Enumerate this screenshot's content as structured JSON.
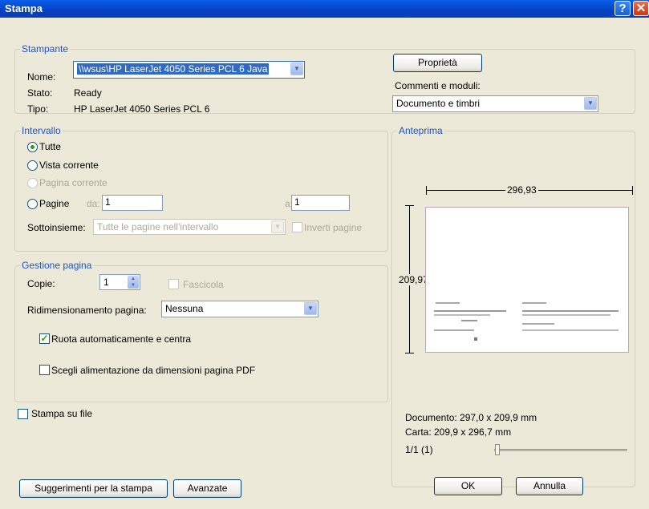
{
  "window": {
    "title": "Stampa"
  },
  "printer": {
    "group_label": "Stampante",
    "name_label": "Nome:",
    "name_value": "\\\\wsus\\HP LaserJet 4050 Series PCL 6 Java",
    "status_label": "Stato:",
    "status_value": "Ready",
    "type_label": "Tipo:",
    "type_value": "HP LaserJet 4050 Series PCL 6",
    "properties_button": "Proprietà",
    "comments_label": "Commenti e moduli:",
    "comments_value": "Documento e timbri"
  },
  "range": {
    "group_label": "Intervallo",
    "all": "Tutte",
    "current_view": "Vista corrente",
    "current_page": "Pagina corrente",
    "pages": "Pagine",
    "from_label": "da:",
    "from_value": "1",
    "to_label": "a:",
    "to_value": "1",
    "subset_label": "Sottoinsieme:",
    "subset_value": "Tutte le pagine nell'intervallo",
    "reverse_label": "Inverti pagine"
  },
  "page_handling": {
    "group_label": "Gestione pagina",
    "copies_label": "Copie:",
    "copies_value": "1",
    "collate_label": "Fascicola",
    "scaling_label": "Ridimensionamento pagina:",
    "scaling_value": "Nessuna",
    "auto_rotate_label": "Ruota automaticamente e centra",
    "auto_rotate_checked": true,
    "choose_source_label": "Scegli alimentazione da dimensioni pagina PDF",
    "choose_source_checked": false
  },
  "print_to_file": {
    "label": "Stampa su file",
    "checked": false
  },
  "preview": {
    "group_label": "Anteprima",
    "width_value": "296,93",
    "height_value": "209,97",
    "document_size": "Documento: 297,0 x 209,9 mm",
    "paper_size": "Carta: 209,9 x 296,7 mm",
    "page_counter": "1/1 (1)"
  },
  "buttons": {
    "tips": "Suggerimenti per la stampa",
    "advanced": "Avanzate",
    "ok": "OK",
    "cancel": "Annulla"
  },
  "colors": {
    "titlebar": "#0541c4",
    "dialog_bg": "#ece9d8",
    "group_label": "#1f52c4",
    "check_mark": "#21a121"
  }
}
